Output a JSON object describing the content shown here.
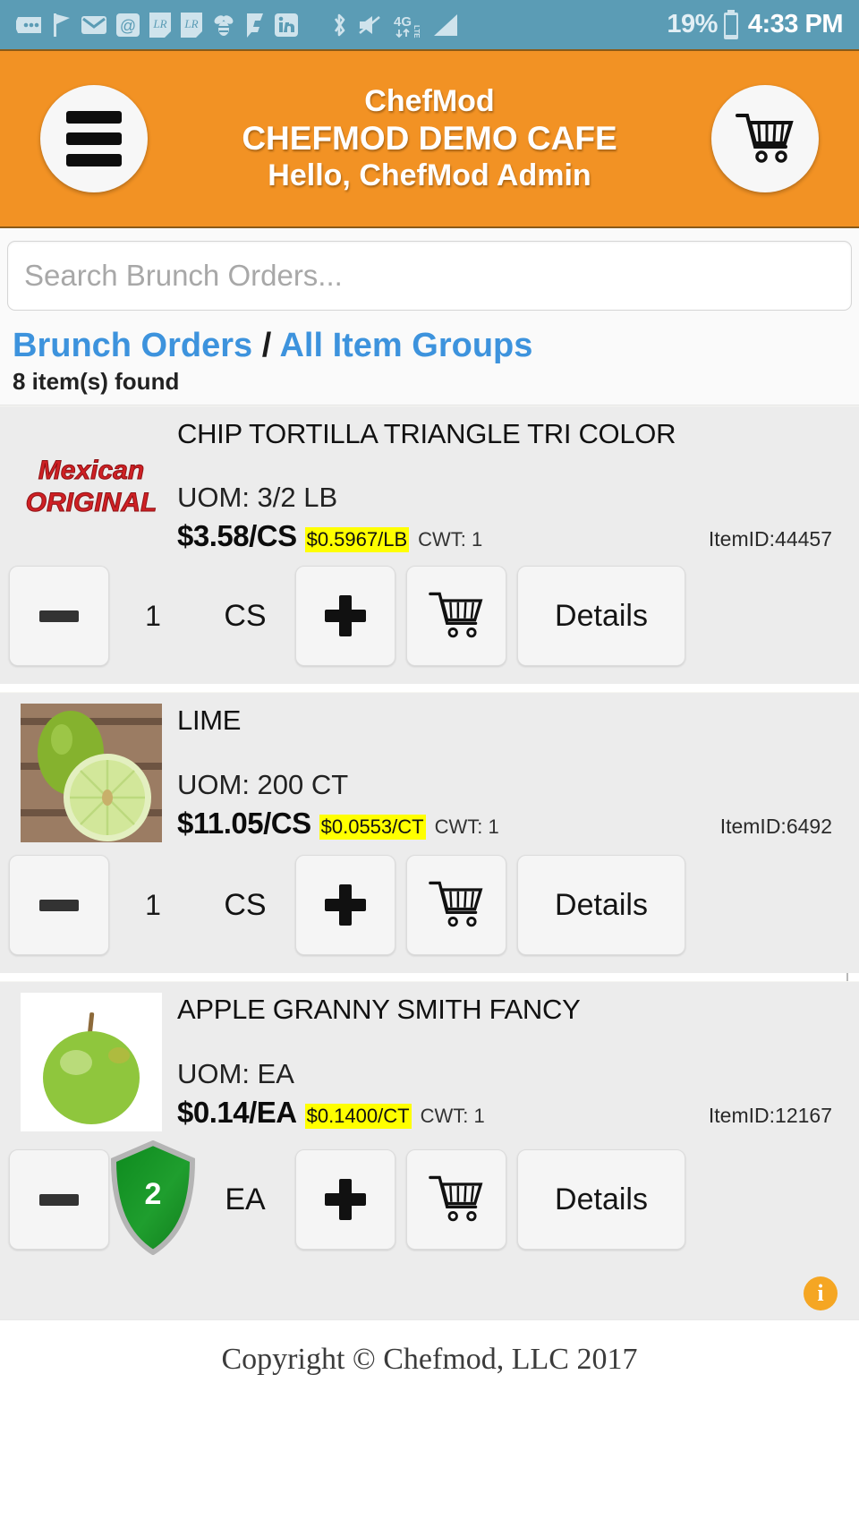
{
  "status_bar": {
    "icons": [
      "messages-icon",
      "flag-icon",
      "mail-icon",
      "at-mention-icon",
      "note-lr-icon",
      "note-lr-icon-2",
      "bee-icon",
      "foursquare-icon",
      "linkedin-icon"
    ],
    "bluetooth_icon": "bluetooth-icon",
    "mute_icon": "volume-mute-icon",
    "network_type": "4G LTE",
    "signal_icon": "signal-bars-icon",
    "battery_percent": "19%",
    "battery_icon": "battery-icon",
    "time": "4:33 PM"
  },
  "header": {
    "menu_icon": "hamburger-menu-icon",
    "cart_icon": "shopping-cart-icon",
    "app_name": "ChefMod",
    "account_name": "CHEFMOD DEMO CAFE",
    "greeting": "Hello, ChefMod Admin",
    "background_color": "#f29224"
  },
  "search": {
    "placeholder": "Search Brunch Orders...",
    "value": ""
  },
  "breadcrumb": {
    "parent": "Brunch Orders",
    "separator": "/",
    "current": "All Item Groups",
    "result_count": "8 item(s) found",
    "link_color": "#3d93dd"
  },
  "products": [
    {
      "name": "CHIP TORTILLA TRIANGLE TRI COLOR",
      "thumbnail": "mexican-original-logo",
      "uom_label": "UOM: 3/2 LB",
      "price": "$3.58/CS",
      "unit_price": "$0.5967/LB",
      "cwt": "CWT: 1",
      "item_id": "ItemID:44457",
      "quantity": "1",
      "unit": "CS",
      "quantity_highlighted": false,
      "minus_label": "minus",
      "plus_label": "plus",
      "cart_label": "add-to-cart",
      "details_label": "Details"
    },
    {
      "name": "LIME",
      "thumbnail": "lime-photo",
      "uom_label": "UOM: 200 CT",
      "price": "$11.05/CS",
      "unit_price": "$0.0553/CT",
      "cwt": "CWT: 1",
      "item_id": "ItemID:6492",
      "quantity": "1",
      "unit": "CS",
      "quantity_highlighted": false,
      "minus_label": "minus",
      "plus_label": "plus",
      "cart_label": "add-to-cart",
      "details_label": "Details"
    },
    {
      "name": "APPLE GRANNY SMITH FANCY",
      "thumbnail": "green-apple-photo",
      "uom_label": "UOM: EA",
      "price": "$0.14/EA",
      "unit_price": "$0.1400/CT",
      "cwt": "CWT: 1",
      "item_id": "ItemID:12167",
      "quantity": "2",
      "unit": "EA",
      "quantity_highlighted": true,
      "minus_label": "minus",
      "plus_label": "plus",
      "cart_label": "add-to-cart",
      "details_label": "Details"
    }
  ],
  "info_badge": {
    "label": "i",
    "color": "#f5a623"
  },
  "footer": {
    "copyright": "Copyright © Chefmod, LLC 2017"
  }
}
